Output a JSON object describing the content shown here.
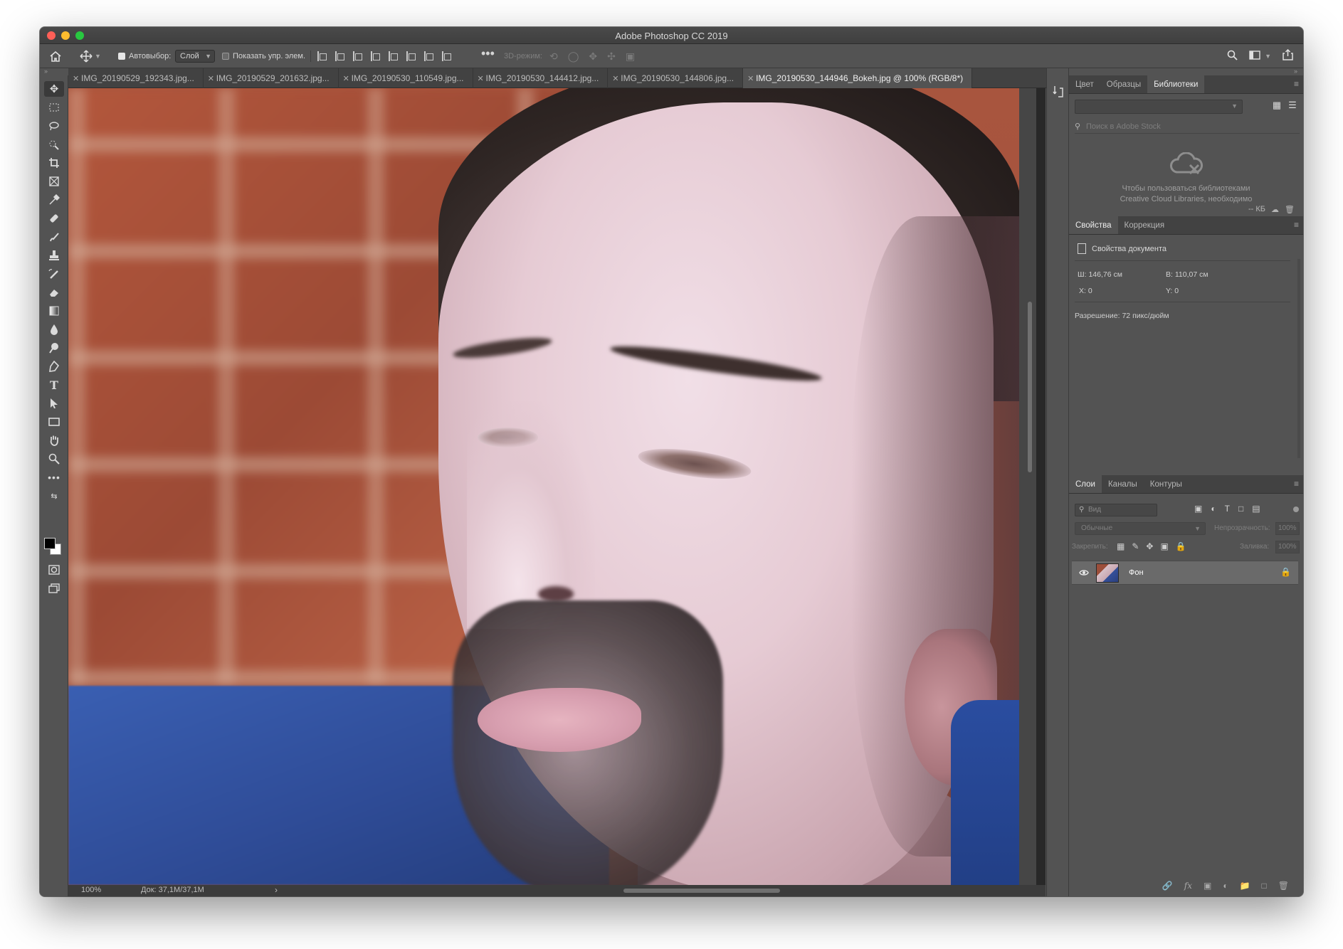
{
  "window": {
    "title": "Adobe Photoshop CC 2019"
  },
  "options_bar": {
    "autoselect_label": "Автовыбор:",
    "autoselect_checked": true,
    "autoselect_value": "Слой",
    "show_controls_label": "Показать упр. элем.",
    "show_controls_checked": false,
    "more_label": "•••",
    "mode3d_label": "3D-режим:"
  },
  "tabs": [
    {
      "label": "IMG_20190529_192343.jpg...",
      "active": false
    },
    {
      "label": "IMG_20190529_201632.jpg...",
      "active": false
    },
    {
      "label": "IMG_20190530_110549.jpg...",
      "active": false
    },
    {
      "label": "IMG_20190530_144412.jpg...",
      "active": false
    },
    {
      "label": "IMG_20190530_144806.jpg...",
      "active": false
    },
    {
      "label": "IMG_20190530_144946_Bokeh.jpg @ 100% (RGB/8*)",
      "active": true
    }
  ],
  "tools": [
    "move-tool-icon",
    "marquee-tool-icon",
    "lasso-tool-icon",
    "quick-select-tool-icon",
    "crop-tool-icon",
    "frame-tool-icon",
    "eyedropper-tool-icon",
    "healing-brush-tool-icon",
    "brush-tool-icon",
    "clone-stamp-tool-icon",
    "history-brush-tool-icon",
    "eraser-tool-icon",
    "gradient-tool-icon",
    "blur-tool-icon",
    "dodge-tool-icon",
    "pen-tool-icon",
    "type-tool-icon",
    "path-select-tool-icon",
    "rectangle-tool-icon",
    "hand-tool-icon",
    "zoom-tool-icon",
    "more-tools-icon"
  ],
  "libraries_panel": {
    "tabs": [
      "Цвет",
      "Образцы",
      "Библиотеки"
    ],
    "active_tab": "Библиотеки",
    "search_placeholder": "Поиск в Adobe Stock",
    "message_line1": "Чтобы пользоваться библиотеками",
    "message_line2": "Creative Cloud Libraries, необходимо",
    "storage_label": "-- КБ"
  },
  "properties_panel": {
    "tabs": [
      "Свойства",
      "Коррекция"
    ],
    "active_tab": "Свойства",
    "doc_label": "Свойства документа",
    "width": "Ш: 146,76 см",
    "height": "В: 110,07 см",
    "x": "X: 0",
    "y": "Y: 0",
    "resolution": "Разрешение: 72 пикс/дюйм"
  },
  "layers_panel": {
    "tabs": [
      "Слои",
      "Каналы",
      "Контуры"
    ],
    "active_tab": "Слои",
    "filter_placeholder": "Вид",
    "blend_mode": "Обычные",
    "opacity_label": "Непрозрачность:",
    "opacity_value": "100%",
    "lock_label": "Закрепить:",
    "fill_label": "Заливка:",
    "fill_value": "100%",
    "layers": [
      {
        "name": "Фон",
        "visible": true,
        "locked": true
      }
    ]
  },
  "status_bar": {
    "zoom": "100%",
    "doc_info": "Док: 37,1M/37,1M",
    "arrow": "›"
  },
  "colors": {
    "foreground": "#000000",
    "background": "#ffffff",
    "ui_panel": "#535353",
    "ui_dark": "#424242"
  }
}
